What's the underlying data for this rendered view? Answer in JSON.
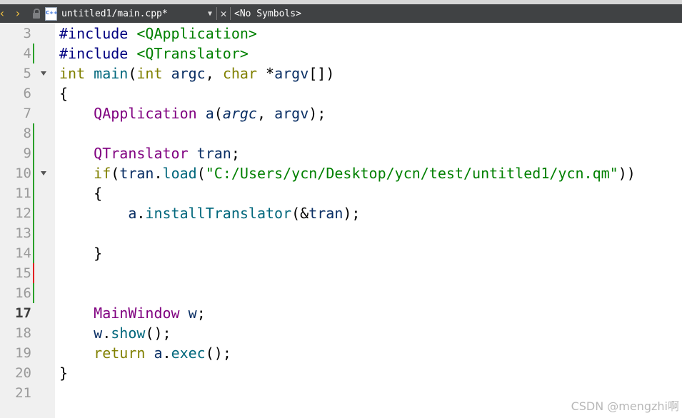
{
  "toolbar": {
    "back_icon": "chevron-left-icon",
    "forward_icon": "chevron-right-icon",
    "lock_icon": "lock-icon",
    "file_type_icon_text": "C++",
    "filename": "untitled1/main.cpp*",
    "symbols": "<No Symbols>"
  },
  "colors": {
    "toolbar_bg": "#404244",
    "gutter_bg": "#f0f0f0",
    "modified_marker": "#2aa02a",
    "error_marker": "#e02020",
    "nav_arrows": "#f0c040"
  },
  "lines": [
    {
      "n": "3",
      "tokens": [
        [
          "pre",
          "#include"
        ],
        [
          "p",
          " "
        ],
        [
          "inc",
          "<QApplication>"
        ]
      ]
    },
    {
      "n": "4",
      "mark": "green",
      "tokens": [
        [
          "pre",
          "#include"
        ],
        [
          "p",
          " "
        ],
        [
          "inc",
          "<QTranslator>"
        ]
      ]
    },
    {
      "n": "5",
      "fold": true,
      "tokens": [
        [
          "kw",
          "int"
        ],
        [
          "p",
          " "
        ],
        [
          "fn",
          "main"
        ],
        [
          "p",
          "("
        ],
        [
          "kw",
          "int"
        ],
        [
          "p",
          " "
        ],
        [
          "var",
          "argc"
        ],
        [
          "p",
          ", "
        ],
        [
          "kw",
          "char"
        ],
        [
          "p",
          " *"
        ],
        [
          "var",
          "argv"
        ],
        [
          "p",
          "[])"
        ]
      ]
    },
    {
      "n": "6",
      "tokens": [
        [
          "p",
          "{"
        ]
      ]
    },
    {
      "n": "7",
      "tokens": [
        [
          "p",
          "    "
        ],
        [
          "type",
          "QApplication"
        ],
        [
          "p",
          " "
        ],
        [
          "var",
          "a"
        ],
        [
          "p",
          "("
        ],
        [
          "par",
          "argc"
        ],
        [
          "p",
          ", "
        ],
        [
          "var",
          "argv"
        ],
        [
          "p",
          ");"
        ]
      ]
    },
    {
      "n": "8",
      "mark": "green",
      "tokens": []
    },
    {
      "n": "9",
      "mark": "green",
      "tokens": [
        [
          "p",
          "    "
        ],
        [
          "type",
          "QTranslator"
        ],
        [
          "p",
          " "
        ],
        [
          "var",
          "tran"
        ],
        [
          "p",
          ";"
        ]
      ]
    },
    {
      "n": "10",
      "mark": "green",
      "fold": true,
      "tokens": [
        [
          "p",
          "    "
        ],
        [
          "kw",
          "if"
        ],
        [
          "p",
          "("
        ],
        [
          "var",
          "tran"
        ],
        [
          "p",
          "."
        ],
        [
          "fn",
          "load"
        ],
        [
          "p",
          "("
        ],
        [
          "str",
          "\"C:/Users/ycn/Desktop/ycn/test/untitled1/ycn.qm\""
        ],
        [
          "p",
          "))"
        ]
      ]
    },
    {
      "n": "11",
      "mark": "green",
      "tokens": [
        [
          "p",
          "    {"
        ]
      ]
    },
    {
      "n": "12",
      "mark": "green",
      "tokens": [
        [
          "p",
          "        "
        ],
        [
          "var",
          "a"
        ],
        [
          "p",
          "."
        ],
        [
          "fn",
          "installTranslator"
        ],
        [
          "p",
          "(&"
        ],
        [
          "var",
          "tran"
        ],
        [
          "p",
          ");"
        ]
      ]
    },
    {
      "n": "13",
      "mark": "green",
      "tokens": []
    },
    {
      "n": "14",
      "mark": "green",
      "tokens": [
        [
          "p",
          "    }"
        ]
      ]
    },
    {
      "n": "15",
      "mark": "red",
      "tokens": []
    },
    {
      "n": "16",
      "mark": "green",
      "tokens": []
    },
    {
      "n": "17",
      "current": true,
      "tokens": [
        [
          "p",
          "    "
        ],
        [
          "type",
          "MainWindow"
        ],
        [
          "p",
          " "
        ],
        [
          "var",
          "w"
        ],
        [
          "p",
          ";"
        ]
      ]
    },
    {
      "n": "18",
      "tokens": [
        [
          "p",
          "    "
        ],
        [
          "var",
          "w"
        ],
        [
          "p",
          "."
        ],
        [
          "fn",
          "show"
        ],
        [
          "p",
          "();"
        ]
      ]
    },
    {
      "n": "19",
      "tokens": [
        [
          "p",
          "    "
        ],
        [
          "kw",
          "return"
        ],
        [
          "p",
          " "
        ],
        [
          "var",
          "a"
        ],
        [
          "p",
          "."
        ],
        [
          "fn",
          "exec"
        ],
        [
          "p",
          "();"
        ]
      ]
    },
    {
      "n": "20",
      "tokens": [
        [
          "p",
          "}"
        ]
      ]
    },
    {
      "n": "21",
      "tokens": []
    }
  ],
  "watermark": "CSDN @mengzhi啊"
}
